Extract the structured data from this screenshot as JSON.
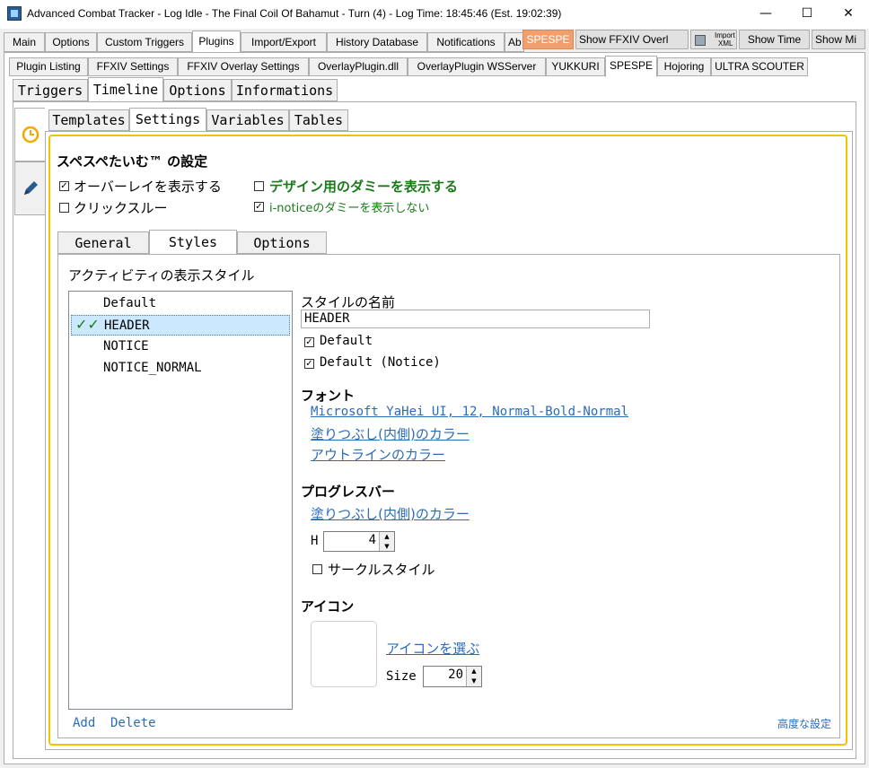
{
  "window": {
    "title": "Advanced Combat Tracker - Log Idle - The Final Coil Of Bahamut - Turn (4) - Log Time: 18:45:46 (Est. 19:02:39)",
    "minimize": "—",
    "maximize": "☐",
    "close": "✕"
  },
  "main_tabs": [
    "Main",
    "Options",
    "Custom Triggers",
    "Plugins",
    "Import/Export",
    "History Database",
    "Notifications",
    "Ab"
  ],
  "toolbar": {
    "spespe": "SPESPE",
    "show_overlay": "Show  FFXIV Overl",
    "import_xml_1": "Import",
    "import_xml_2": "XML",
    "show_time": "Show Time",
    "show_mi": "Show Mi"
  },
  "plugin_tabs": [
    "Plugin Listing",
    "FFXIV Settings",
    "FFXIV Overlay Settings",
    "OverlayPlugin.dll",
    "OverlayPlugin WSServer",
    "YUKKURI",
    "SPESPE",
    "Hojoring",
    "ULTRA SCOUTER"
  ],
  "spespe_tabs": [
    "Triggers",
    "Timeline",
    "Options",
    "Informations"
  ],
  "timeline_tabs": [
    "Templates",
    "Settings",
    "Variables",
    "Tables"
  ],
  "settings": {
    "heading": "スペスペたいむ™ の設定",
    "show_overlay": "オーバーレイを表示する",
    "click_through": "クリックスルー",
    "show_dummy": "デザイン用のダミーを表示する",
    "hide_inotice_dummy": "i-noticeのダミーを表示しない"
  },
  "inner_tabs": [
    "General",
    "Styles",
    "Options"
  ],
  "styles": {
    "section_label": "アクティビティの表示スタイル",
    "list": [
      "Default",
      "HEADER",
      "NOTICE",
      "NOTICE_NORMAL"
    ],
    "selected_index": 1,
    "check_marks": "✓✓",
    "name_label": "スタイルの名前",
    "name_value": "HEADER",
    "default_label": "Default",
    "default_notice_label": "Default (Notice)",
    "font_heading": "フォント",
    "font_value": "Microsoft YaHei UI, 12, Normal-Bold-Normal",
    "fill_color": "塗りつぶし(内側)のカラー",
    "outline_color": "アウトラインのカラー",
    "progress_heading": "プログレスバー",
    "progress_fill_color": "塗りつぶし(内側)のカラー",
    "h_label": "H",
    "h_value": "4",
    "circle_style": "サークルスタイル",
    "icon_heading": "アイコン",
    "choose_icon": "アイコンを選ぶ",
    "size_label": "Size",
    "size_value": "20",
    "add": "Add",
    "delete": "Delete",
    "advanced": "高度な設定"
  },
  "colors": {
    "accent_orange": "#f0a070",
    "frame_yellow": "#f2c400",
    "green_text": "#1a7a1a",
    "link_blue": "#2b6cb8"
  }
}
